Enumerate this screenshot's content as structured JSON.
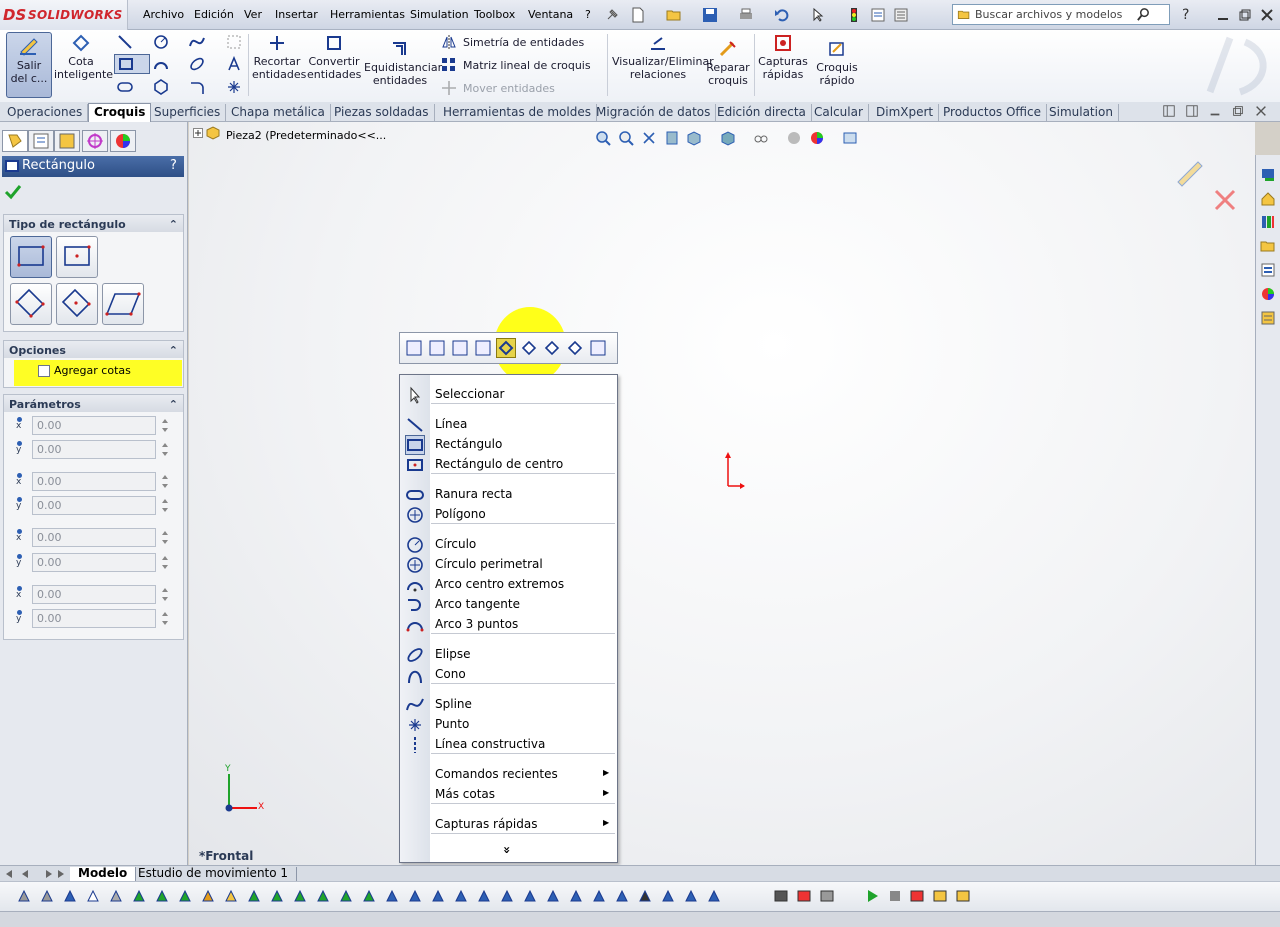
{
  "app": {
    "brand_ds": "DS",
    "brand_name": "SOLIDWORKS"
  },
  "menu": [
    "Archivo",
    "Edición",
    "Ver",
    "Insertar",
    "Herramientas",
    "Simulation",
    "Toolbox",
    "Ventana",
    "?"
  ],
  "search": {
    "placeholder": "Buscar archivos y modelos"
  },
  "ribbon": {
    "exit_sketch": "Salir\ndel c...",
    "smart_dim": "Cota\ninteligente",
    "trim": "Recortar\nentidades",
    "convert": "Convertir\nentidades",
    "offset": "Equidistanciar\nentidades",
    "mirror": "Simetría de entidades",
    "linear_pattern": "Matriz lineal de croquis",
    "move": "Mover entidades",
    "relations": "Visualizar/Eliminar\nrelaciones",
    "repair": "Reparar\ncroquis",
    "quick_snaps": "Capturas\nrápidas",
    "rapid_sketch": "Croquis\nrápido"
  },
  "tabs": [
    "Operaciones",
    "Croquis",
    "Superficies",
    "Chapa metálica",
    "Piezas soldadas",
    "Herramientas de moldes",
    "Migración de datos",
    "Edición directa",
    "Calcular",
    "DimXpert",
    "Productos Office",
    "Simulation"
  ],
  "active_tab": "Croquis",
  "tree": {
    "item": "Pieza2  (Predeterminado<<..."
  },
  "pm": {
    "title": "Rectángulo",
    "help": "?",
    "group_type": "Tipo de rectángulo",
    "group_options": "Opciones",
    "add_dims": "Agregar cotas",
    "group_params": "Parámetros",
    "params": [
      {
        "label": "x",
        "value": "0.00"
      },
      {
        "label": "y",
        "value": "0.00"
      },
      {
        "label": "x",
        "value": "0.00"
      },
      {
        "label": "y",
        "value": "0.00"
      },
      {
        "label": "x",
        "value": "0.00"
      },
      {
        "label": "y",
        "value": "0.00"
      },
      {
        "label": "x",
        "value": "0.00"
      },
      {
        "label": "y",
        "value": "0.00"
      }
    ]
  },
  "context_menu": {
    "select": "Seleccionar",
    "line": "Línea",
    "rect": "Rectángulo",
    "center_rect": "Rectángulo de centro",
    "slot": "Ranura recta",
    "polygon": "Polígono",
    "circle": "Círculo",
    "perim_circle": "Círculo perimetral",
    "center_arc": "Arco centro extremos",
    "tangent_arc": "Arco tangente",
    "arc3": "Arco 3 puntos",
    "ellipse": "Elipse",
    "cone": "Cono",
    "spline": "Spline",
    "point": "Punto",
    "construction": "Línea constructiva",
    "recent": "Comandos recientes",
    "more_dims": "Más cotas",
    "snaps": "Capturas rápidas",
    "expand": "»"
  },
  "view_label": "*Frontal",
  "bottom_tabs": [
    "Modelo",
    "Estudio de movimiento 1"
  ],
  "triad": {
    "x": "X",
    "y": "Y"
  }
}
